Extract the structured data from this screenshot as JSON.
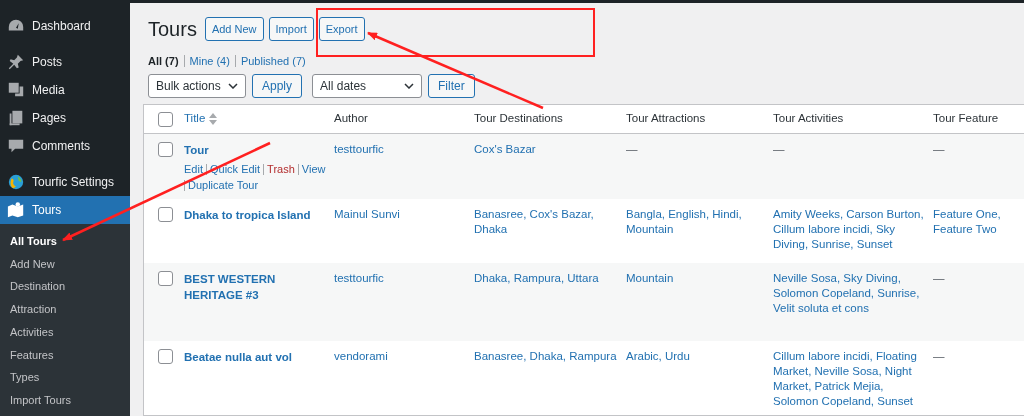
{
  "sidebar": {
    "items": [
      {
        "label": "Dashboard",
        "selected": false
      },
      {
        "label": "Posts",
        "selected": false
      },
      {
        "label": "Media",
        "selected": false
      },
      {
        "label": "Pages",
        "selected": false
      },
      {
        "label": "Comments",
        "selected": false
      },
      {
        "label": "Tourfic Settings",
        "selected": false
      },
      {
        "label": "Tours",
        "selected": true,
        "children": [
          {
            "label": "All Tours",
            "selected": true
          },
          {
            "label": "Add New",
            "selected": false
          },
          {
            "label": "Destination",
            "selected": false
          },
          {
            "label": "Attraction",
            "selected": false
          },
          {
            "label": "Activities",
            "selected": false
          },
          {
            "label": "Features",
            "selected": false
          },
          {
            "label": "Types",
            "selected": false
          },
          {
            "label": "Import Tours",
            "selected": false
          }
        ]
      }
    ]
  },
  "page": {
    "title": "Tours",
    "buttons": [
      "Add New",
      "Import",
      "Export"
    ]
  },
  "views": [
    {
      "label": "All",
      "count": "(7)",
      "selected": true
    },
    {
      "label": "Mine",
      "count": "(4)",
      "selected": false
    },
    {
      "label": "Published",
      "count": "(7)",
      "selected": false
    }
  ],
  "filters": {
    "bulk_actions": "Bulk actions",
    "apply": "Apply",
    "dates": "All dates",
    "filter": "Filter"
  },
  "table": {
    "select_all_checked": false,
    "columns": [
      "Title",
      "Author",
      "Tour Destinations",
      "Tour Attractions",
      "Tour Activities",
      "Tour Feature"
    ],
    "rows": [
      {
        "title": "Tour",
        "checked": false,
        "actions": [
          {
            "label": "Edit",
            "kind": "normal"
          },
          {
            "label": "Quick Edit",
            "kind": "normal"
          },
          {
            "label": "Trash",
            "kind": "danger"
          },
          {
            "label": "View",
            "kind": "normal"
          },
          {
            "label": "Duplicate Tour",
            "kind": "normal"
          }
        ],
        "author": "testtourfic",
        "destinations": "Cox's Bazar",
        "attractions": "—",
        "activities": "—",
        "features": "—"
      },
      {
        "title": "Dhaka to tropica Island",
        "checked": false,
        "author": "Mainul Sunvi",
        "destinations": "Banasree, Cox's Bazar, Dhaka",
        "attractions": "Bangla, English, Hindi, Mountain",
        "activities": "Amity Weeks, Carson Burton, Cillum labore incidi, Sky Diving, Sunrise, Sunset",
        "features": "Feature One, Feature Two"
      },
      {
        "title": "BEST WESTERN HERITAGE #3",
        "checked": false,
        "author": "testtourfic",
        "destinations": "Dhaka, Rampura, Uttara",
        "attractions": "Mountain",
        "activities": "Neville Sosa, Sky Diving, Solomon Copeland, Sunrise, Velit soluta et cons",
        "features": "—"
      },
      {
        "title": "Beatae nulla aut vol",
        "checked": false,
        "author": "vendorami",
        "destinations": "Banasree, Dhaka, Rampura",
        "attractions": "Arabic, Urdu",
        "activities": "Cillum labore incidi, Floating Market, Neville Sosa, Night Market, Patrick Mejia, Solomon Copeland, Sunset",
        "features": "—"
      }
    ]
  }
}
